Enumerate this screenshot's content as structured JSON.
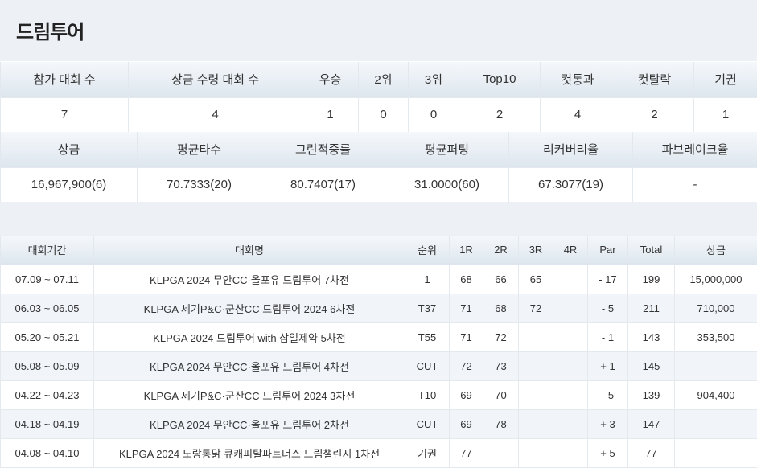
{
  "page": {
    "title": "드림투어"
  },
  "stats1": {
    "headers": [
      "참가 대회 수",
      "상금 수령 대회 수",
      "우승",
      "2위",
      "3위",
      "Top10",
      "컷통과",
      "컷탈락",
      "기권"
    ],
    "values": [
      "7",
      "4",
      "1",
      "0",
      "0",
      "2",
      "4",
      "2",
      "1"
    ]
  },
  "stats2": {
    "headers": [
      "상금",
      "평균타수",
      "그린적중률",
      "평균퍼팅",
      "리커버리율",
      "파브레이크율"
    ],
    "values": [
      "16,967,900(6)",
      "70.7333(20)",
      "80.7407(17)",
      "31.0000(60)",
      "67.3077(19)",
      "-"
    ]
  },
  "results": {
    "headers": [
      "대회기간",
      "대회명",
      "순위",
      "1R",
      "2R",
      "3R",
      "4R",
      "Par",
      "Total",
      "상금"
    ],
    "rows": [
      [
        "07.09 ~ 07.11",
        "KLPGA 2024 무안CC·올포유 드림투어 7차전",
        "1",
        "68",
        "66",
        "65",
        "",
        "- 17",
        "199",
        "15,000,000"
      ],
      [
        "06.03 ~ 06.05",
        "KLPGA 세기P&C·군산CC 드림투어 2024 6차전",
        "T37",
        "71",
        "68",
        "72",
        "",
        "- 5",
        "211",
        "710,000"
      ],
      [
        "05.20 ~ 05.21",
        "KLPGA 2024 드림투어 with 삼일제약 5차전",
        "T55",
        "71",
        "72",
        "",
        "",
        "- 1",
        "143",
        "353,500"
      ],
      [
        "05.08 ~ 05.09",
        "KLPGA 2024 무안CC·올포유 드림투어 4차전",
        "CUT",
        "72",
        "73",
        "",
        "",
        "+ 1",
        "145",
        ""
      ],
      [
        "04.22 ~ 04.23",
        "KLPGA 세기P&C·군산CC 드림투어 2024 3차전",
        "T10",
        "69",
        "70",
        "",
        "",
        "- 5",
        "139",
        "904,400"
      ],
      [
        "04.18 ~ 04.19",
        "KLPGA 2024 무안CC·올포유 드림투어 2차전",
        "CUT",
        "69",
        "78",
        "",
        "",
        "+ 3",
        "147",
        ""
      ],
      [
        "04.08 ~ 04.10",
        "KLPGA 2024 노랑통닭 큐캐피탈파트너스 드림챌린지 1차전",
        "기권",
        "77",
        "",
        "",
        "",
        "+ 5",
        "77",
        ""
      ]
    ]
  }
}
